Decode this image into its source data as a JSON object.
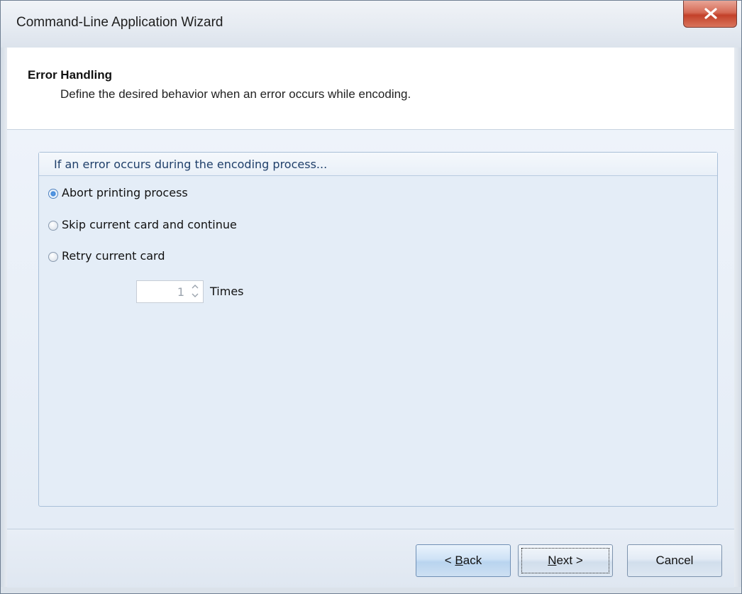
{
  "window": {
    "title": "Command-Line Application Wizard"
  },
  "header": {
    "title": "Error Handling",
    "description": "Define the desired behavior when an error occurs while encoding."
  },
  "group": {
    "title": "If an error occurs during the encoding process...",
    "options": [
      {
        "label": "Abort printing process",
        "checked": true
      },
      {
        "label": "Skip current card and continue",
        "checked": false
      },
      {
        "label": "Retry current card",
        "checked": false
      }
    ],
    "retry_count": {
      "value": "1",
      "unit_label": "Times",
      "enabled": false
    }
  },
  "footer": {
    "back": {
      "prefix": "< ",
      "mnemonic": "B",
      "rest": "ack"
    },
    "next": {
      "mnemonic": "N",
      "rest": "ext >"
    },
    "cancel": "Cancel"
  }
}
